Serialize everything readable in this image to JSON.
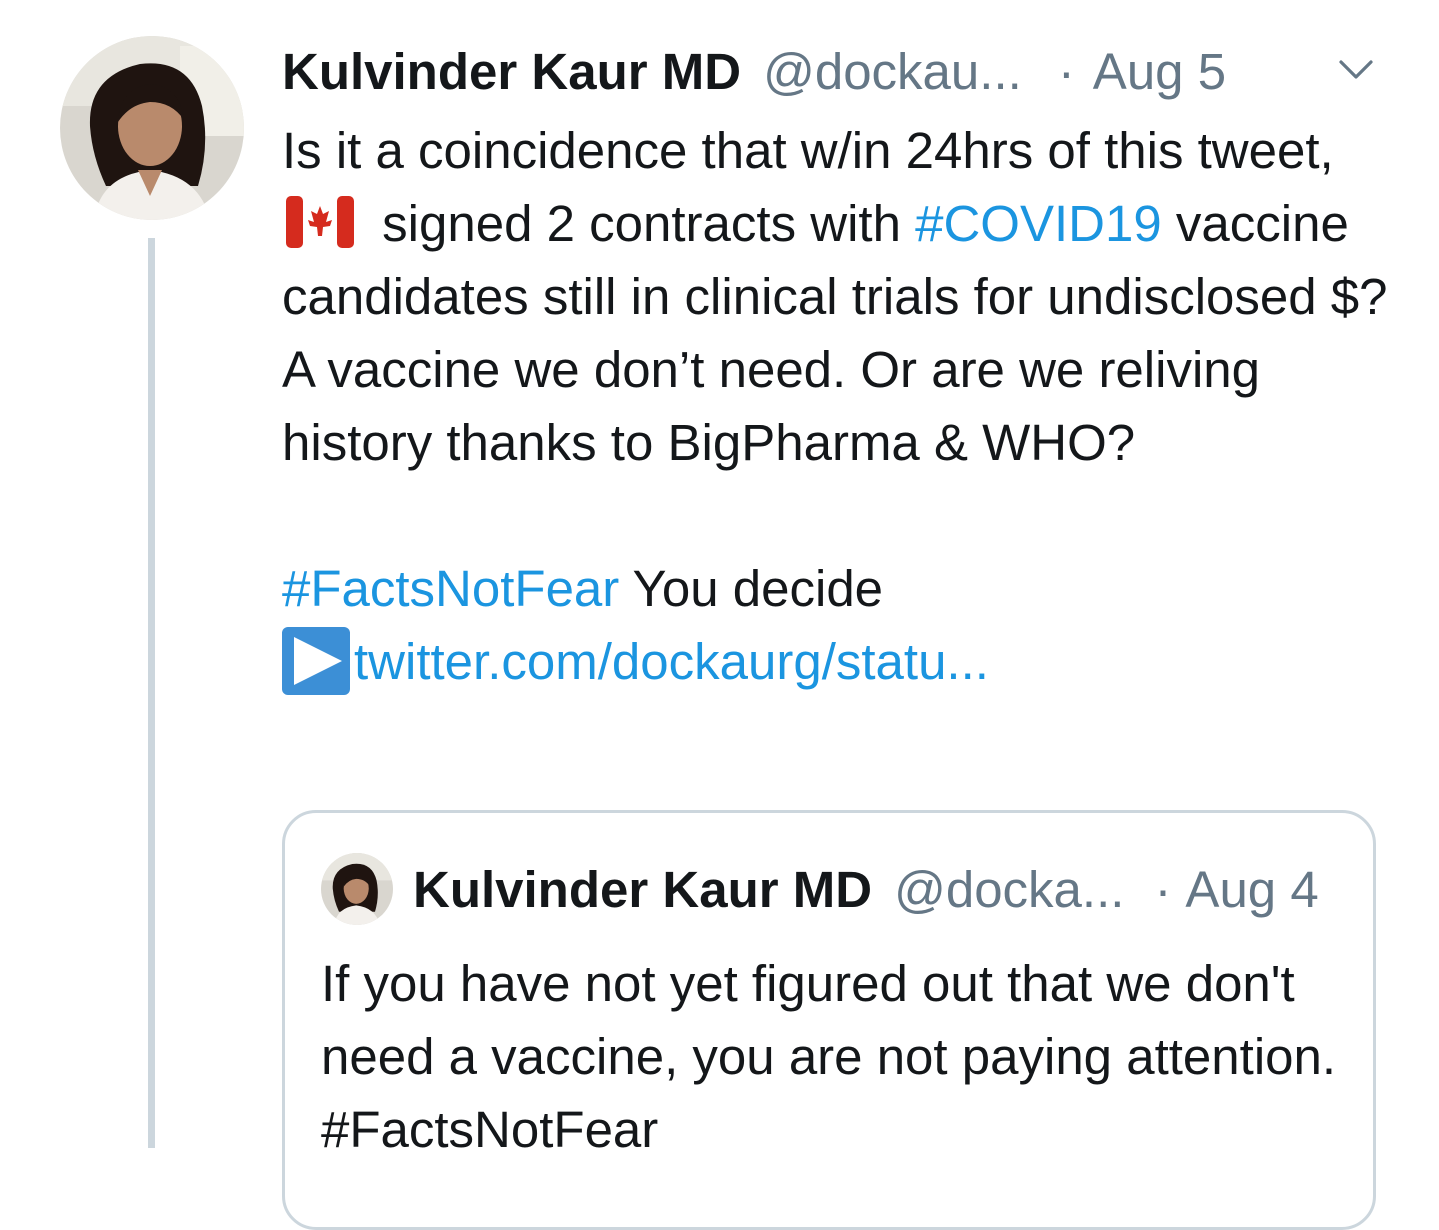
{
  "tweet": {
    "author_name": "Kulvinder Kaur MD",
    "author_handle": "@dockau...",
    "separator": "·",
    "date": "Aug 5",
    "line1": "Is it a coincidence that w/in 24hrs of this tweet,",
    "line1_after_flag": "signed 2 contracts with",
    "hashtag_covid": "#COVID19",
    "text_after_covid": "vaccine candidates still in clinical trials for undisclosed $? A vaccine we don’t need. Or are we reliving history thanks to BigPharma & WHO?",
    "hashtag_facts": "#FactsNotFear",
    "text_after_facts": "You decide",
    "link_text": "twitter.com/dockaurg/statu..."
  },
  "quoted_tweet": {
    "author_name": "Kulvinder Kaur MD",
    "author_handle": "@docka...",
    "separator": "·",
    "date": "Aug 4",
    "text": "If you have not yet figured out that we don't need a vaccine, you are not paying attention.",
    "hashtag": "#FactsNotFear"
  },
  "icons": {
    "avatar": "profile-photo",
    "flag": "canada-flag-emoji",
    "play": "play-button-emoji",
    "menu": "chevron-down-icon"
  },
  "colors": {
    "link": "#1b95e0",
    "secondary_text": "#657786",
    "border": "#ccd6dd",
    "text": "#14171a"
  }
}
